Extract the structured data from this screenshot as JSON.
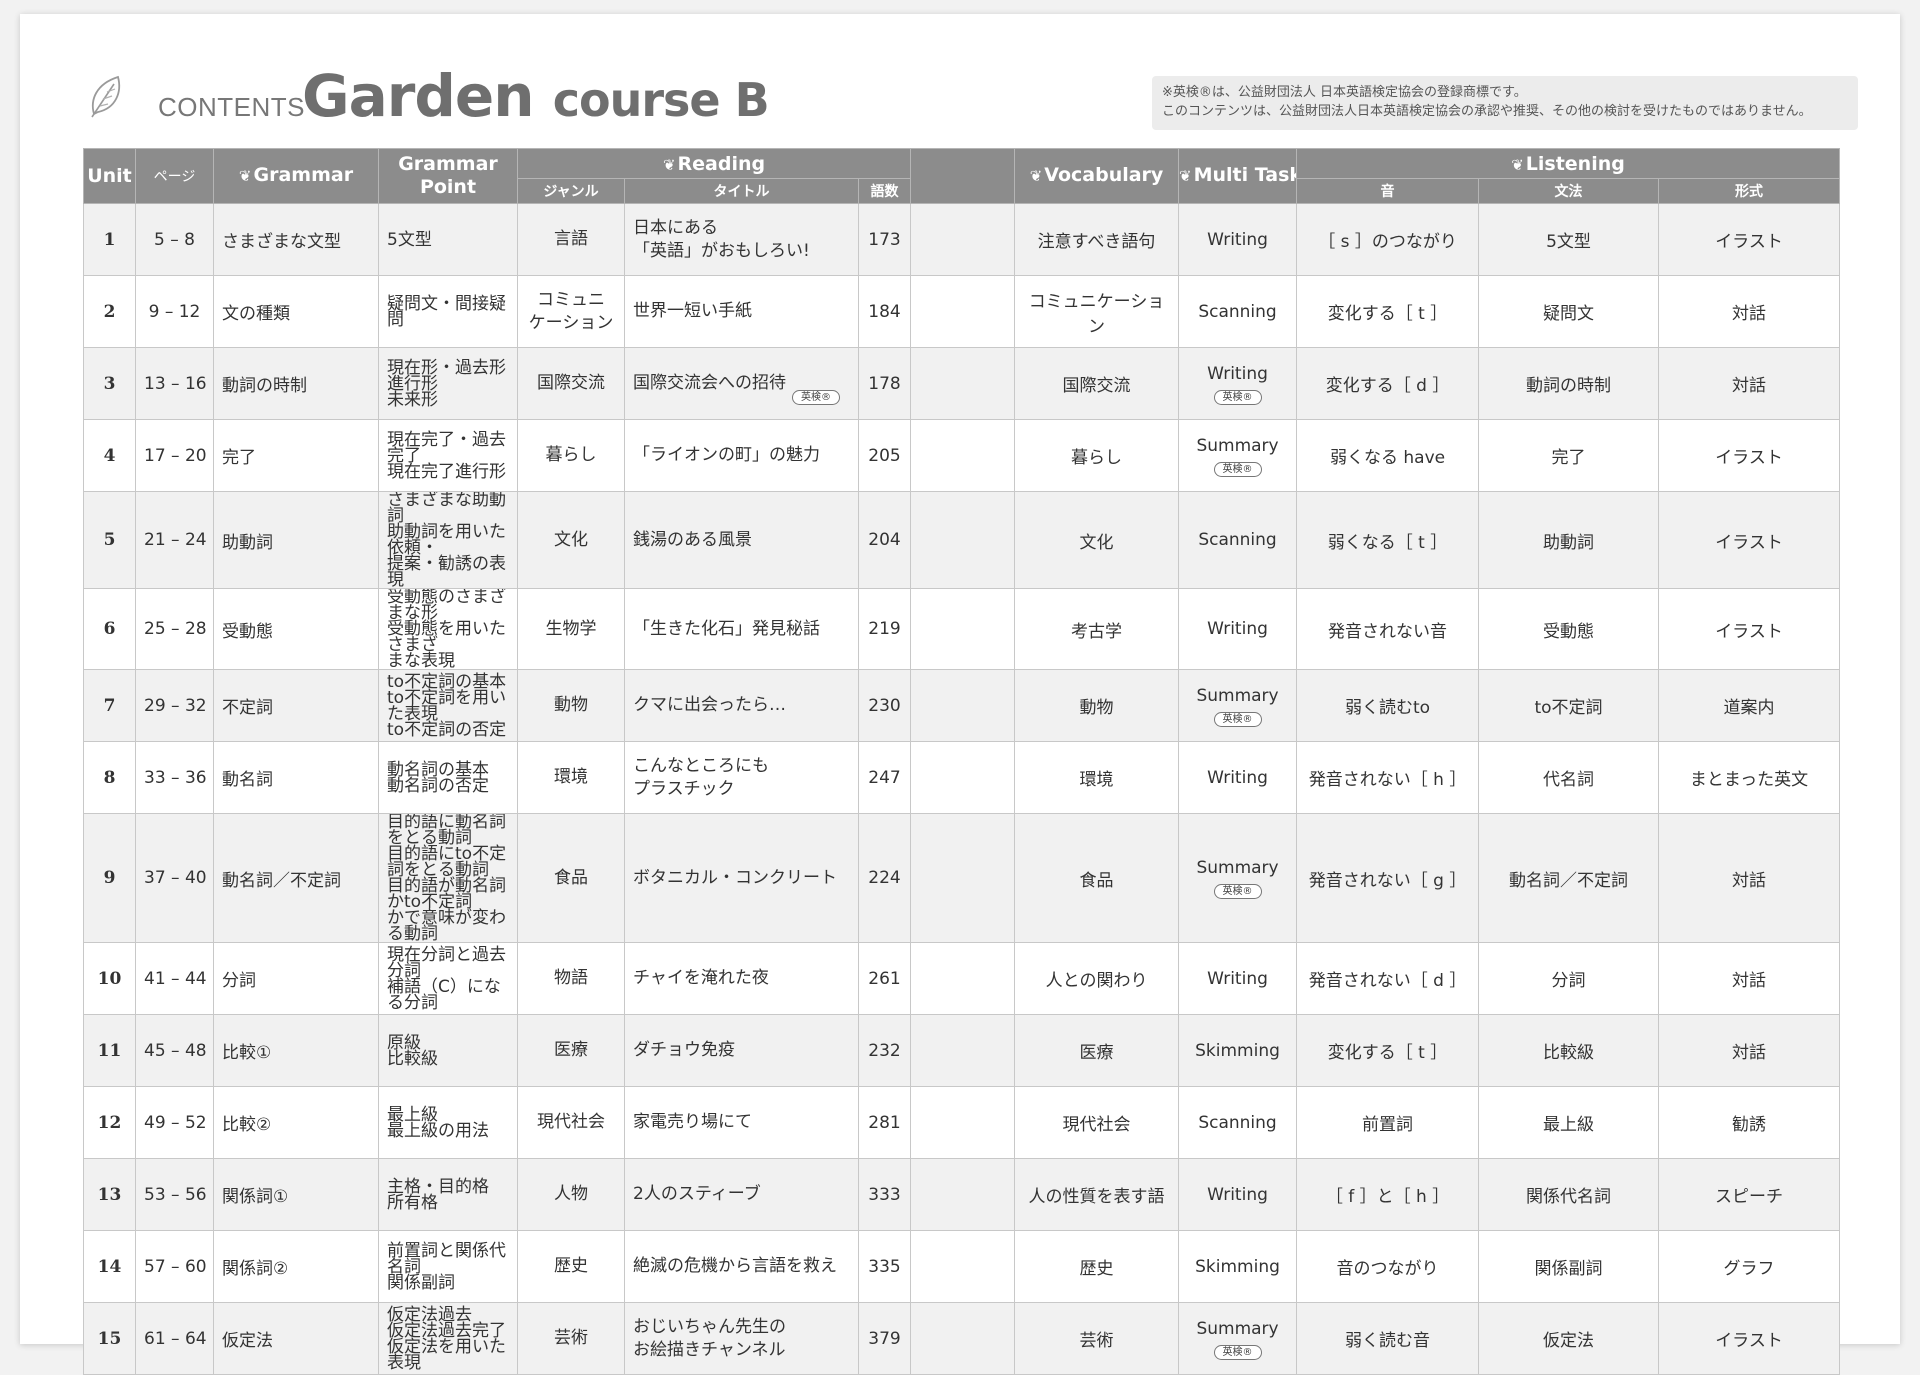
{
  "header": {
    "contents_label": "CONTENTS",
    "title_main": "Garden",
    "title_sub": "course B",
    "notice_line1": "※英検®は、公益財団法人 日本英語検定協会の登録商標です。",
    "notice_line2": "このコンテンツは、公益財団法人日本英語検定協会の承認や推奨、その他の検討を受けたものではありません。"
  },
  "columns": {
    "unit": "Unit",
    "page": "ページ",
    "grammar": "Grammar",
    "grammar_point_1": "Grammar",
    "grammar_point_2": "Point",
    "reading": "Reading",
    "genre": "ジャンル",
    "title": "タイトル",
    "word_count": "語数",
    "vocabulary": "Vocabulary",
    "multi_task": "Multi Task",
    "listening": "Listening",
    "sound": "音",
    "listening_grammar": "文法",
    "format": "形式"
  },
  "colors": {
    "header_bg": "#8c8c8c",
    "row_alt_bg": "#f1f1f1",
    "border": "#c8c8c8"
  },
  "units": [
    {
      "unit": "1",
      "pages": "5 – 8",
      "grammar": "さまざまな文型",
      "grammar_point": [
        "5文型"
      ],
      "genre": [
        "言語"
      ],
      "title": [
        "日本にある",
        "「英語」がおもしろい!"
      ],
      "title_badge": "",
      "words": "173",
      "vocabulary": "注意すべき語句",
      "task": "Writing",
      "task_badge": "",
      "sound": "［ s ］のつながり",
      "l_grammar": "5文型",
      "format": "イラスト"
    },
    {
      "unit": "2",
      "pages": "9 – 12",
      "grammar": "文の種類",
      "grammar_point": [
        "疑問文・間接疑問"
      ],
      "genre": [
        "コミュニ",
        "ケーション"
      ],
      "title": [
        "世界一短い手紙"
      ],
      "title_badge": "",
      "words": "184",
      "vocabulary": "コミュニケーション",
      "task": "Scanning",
      "task_badge": "",
      "sound": "変化する［ t ］",
      "l_grammar": "疑問文",
      "format": "対話"
    },
    {
      "unit": "3",
      "pages": "13 – 16",
      "grammar": "動詞の時制",
      "grammar_point": [
        "現在形・過去形",
        "進行形",
        "未来形"
      ],
      "genre": [
        "国際交流"
      ],
      "title": [
        "国際交流会への招待"
      ],
      "title_badge": "英検®",
      "words": "178",
      "vocabulary": "国際交流",
      "task": "Writing",
      "task_badge": "英検®",
      "sound": "変化する［ d ］",
      "l_grammar": "動詞の時制",
      "format": "対話"
    },
    {
      "unit": "4",
      "pages": "17 – 20",
      "grammar": "完了",
      "grammar_point": [
        "現在完了・過去完了",
        "現在完了進行形"
      ],
      "genre": [
        "暮らし"
      ],
      "title": [
        "「ライオンの町」の魅力"
      ],
      "title_badge": "",
      "words": "205",
      "vocabulary": "暮らし",
      "task": "Summary",
      "task_badge": "英検®",
      "sound": "弱くなる have",
      "l_grammar": "完了",
      "format": "イラスト"
    },
    {
      "unit": "5",
      "pages": "21 – 24",
      "grammar": "助動詞",
      "grammar_point": [
        "さまざまな助動詞",
        "助動詞を用いた依頼・",
        "提案・勧誘の表現"
      ],
      "genre": [
        "文化"
      ],
      "title": [
        "銭湯のある風景"
      ],
      "title_badge": "",
      "words": "204",
      "vocabulary": "文化",
      "task": "Scanning",
      "task_badge": "",
      "sound": "弱くなる［ t ］",
      "l_grammar": "助動詞",
      "format": "イラスト"
    },
    {
      "unit": "6",
      "pages": "25 – 28",
      "grammar": "受動態",
      "grammar_point": [
        "受動態のさまざまな形",
        "受動態を用いたさまざ",
        "まな表現"
      ],
      "genre": [
        "生物学"
      ],
      "title": [
        "「生きた化石」発見秘話"
      ],
      "title_badge": "",
      "words": "219",
      "vocabulary": "考古学",
      "task": "Writing",
      "task_badge": "",
      "sound": "発音されない音",
      "l_grammar": "受動態",
      "format": "イラスト"
    },
    {
      "unit": "7",
      "pages": "29 – 32",
      "grammar": "不定詞",
      "grammar_point": [
        "to不定詞の基本",
        "to不定詞を用いた表現",
        "to不定詞の否定"
      ],
      "genre": [
        "動物"
      ],
      "title": [
        "クマに出会ったら…"
      ],
      "title_badge": "",
      "words": "230",
      "vocabulary": "動物",
      "task": "Summary",
      "task_badge": "英検®",
      "sound": "弱く読むto",
      "l_grammar": "to不定詞",
      "format": "道案内"
    },
    {
      "unit": "8",
      "pages": "33 – 36",
      "grammar": "動名詞",
      "grammar_point": [
        "動名詞の基本",
        "動名詞の否定"
      ],
      "genre": [
        "環境"
      ],
      "title": [
        "こんなところにも",
        "プラスチック"
      ],
      "title_badge": "",
      "words": "247",
      "vocabulary": "環境",
      "task": "Writing",
      "task_badge": "",
      "sound": "発音されない［ h ］",
      "l_grammar": "代名詞",
      "format": "まとまった英文"
    },
    {
      "unit": "9",
      "pages": "37 – 40",
      "grammar": "動名詞／不定詞",
      "grammar_point": [
        "目的語に動名詞をとる動詞",
        "目的語にto不定詞をとる動詞",
        "目的語が動名詞かto不定詞",
        "かで意味が変わる動詞"
      ],
      "genre": [
        "食品"
      ],
      "title": [
        "ボタニカル・コンクリート"
      ],
      "title_badge": "",
      "words": "224",
      "vocabulary": "食品",
      "task": "Summary",
      "task_badge": "英検®",
      "sound": "発音されない［ g ］",
      "l_grammar": "動名詞／不定詞",
      "format": "対話"
    },
    {
      "unit": "10",
      "pages": "41 – 44",
      "grammar": "分詞",
      "grammar_point": [
        "現在分詞と過去分詞",
        "補語（C）になる分詞"
      ],
      "genre": [
        "物語"
      ],
      "title": [
        "チャイを淹れた夜"
      ],
      "title_badge": "",
      "words": "261",
      "vocabulary": "人との関わり",
      "task": "Writing",
      "task_badge": "",
      "sound": "発音されない［ d ］",
      "l_grammar": "分詞",
      "format": "対話"
    },
    {
      "unit": "11",
      "pages": "45 – 48",
      "grammar": "比較①",
      "grammar_point": [
        "原級",
        "比較級"
      ],
      "genre": [
        "医療"
      ],
      "title": [
        "ダチョウ免疫"
      ],
      "title_badge": "",
      "words": "232",
      "vocabulary": "医療",
      "task": "Skimming",
      "task_badge": "",
      "sound": "変化する［ t ］",
      "l_grammar": "比較級",
      "format": "対話"
    },
    {
      "unit": "12",
      "pages": "49 – 52",
      "grammar": "比較②",
      "grammar_point": [
        "最上級",
        "最上級の用法"
      ],
      "genre": [
        "現代社会"
      ],
      "title": [
        "家電売り場にて"
      ],
      "title_badge": "",
      "words": "281",
      "vocabulary": "現代社会",
      "task": "Scanning",
      "task_badge": "",
      "sound": "前置詞",
      "l_grammar": "最上級",
      "format": "勧誘"
    },
    {
      "unit": "13",
      "pages": "53 – 56",
      "grammar": "関係詞①",
      "grammar_point": [
        "主格・目的格",
        "所有格"
      ],
      "genre": [
        "人物"
      ],
      "title": [
        "2人のスティーブ"
      ],
      "title_badge": "",
      "words": "333",
      "vocabulary": "人の性質を表す語",
      "task": "Writing",
      "task_badge": "",
      "sound": "［ f ］と［ h ］",
      "l_grammar": "関係代名詞",
      "format": "スピーチ"
    },
    {
      "unit": "14",
      "pages": "57 – 60",
      "grammar": "関係詞②",
      "grammar_point": [
        "前置詞と関係代名詞",
        "関係副詞"
      ],
      "genre": [
        "歴史"
      ],
      "title": [
        "絶滅の危機から言語を救え"
      ],
      "title_badge": "",
      "words": "335",
      "vocabulary": "歴史",
      "task": "Skimming",
      "task_badge": "",
      "sound": "音のつながり",
      "l_grammar": "関係副詞",
      "format": "グラフ"
    },
    {
      "unit": "15",
      "pages": "61 – 64",
      "grammar": "仮定法",
      "grammar_point": [
        "仮定法過去",
        "仮定法過去完了",
        "仮定法を用いた表現"
      ],
      "genre": [
        "芸術"
      ],
      "title": [
        "おじいちゃん先生の",
        "お絵描きチャンネル"
      ],
      "title_badge": "",
      "words": "379",
      "vocabulary": "芸術",
      "task": "Summary",
      "task_badge": "英検®",
      "sound": "弱く読む音",
      "l_grammar": "仮定法",
      "format": "イラスト"
    }
  ]
}
